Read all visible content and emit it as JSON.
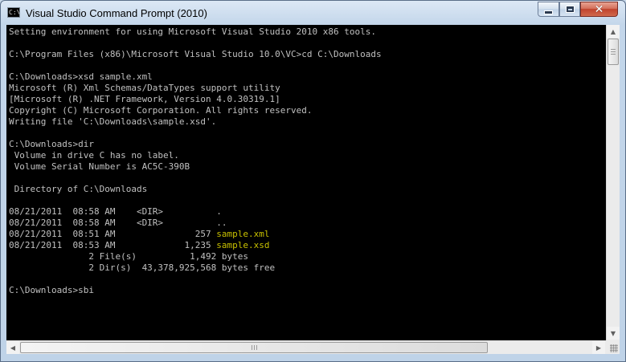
{
  "window": {
    "title": "Visual Studio Command Prompt (2010)",
    "icon_glyph": "C:\\"
  },
  "colors": {
    "console_bg": "#000000",
    "text": "#c0c0c0",
    "highlight": "#c8c000"
  },
  "console": {
    "lines": [
      "Setting environment for using Microsoft Visual Studio 2010 x86 tools.",
      "",
      "C:\\Program Files (x86)\\Microsoft Visual Studio 10.0\\VC>cd C:\\Downloads",
      "",
      "C:\\Downloads>xsd sample.xml",
      "Microsoft (R) Xml Schemas/DataTypes support utility",
      "[Microsoft (R) .NET Framework, Version 4.0.30319.1]",
      "Copyright (C) Microsoft Corporation. All rights reserved.",
      "Writing file 'C:\\Downloads\\sample.xsd'.",
      "",
      "C:\\Downloads>dir",
      " Volume in drive C has no label.",
      " Volume Serial Number is AC5C-390B",
      "",
      " Directory of C:\\Downloads",
      ""
    ],
    "dir_entries": [
      {
        "prefix": "08/21/2011  08:58 AM    <DIR>          ",
        "name": "."
      },
      {
        "prefix": "08/21/2011  08:58 AM    <DIR>          ",
        "name": ".."
      },
      {
        "prefix": "08/21/2011  08:51 AM               257 ",
        "name": "sample.xml"
      },
      {
        "prefix": "08/21/2011  08:53 AM             1,235 ",
        "name": "sample.xsd"
      }
    ],
    "summary": [
      "               2 File(s)          1,492 bytes",
      "               2 Dir(s)  43,378,925,568 bytes free"
    ],
    "prompt": "C:\\Downloads>sbi"
  },
  "icons": {
    "minimize": "minimize-icon",
    "maximize": "maximize-icon",
    "close": "close-icon",
    "close_glyph": "✕",
    "arrow_up": "▲",
    "arrow_down": "▼",
    "arrow_left": "◀",
    "arrow_right": "▶"
  }
}
